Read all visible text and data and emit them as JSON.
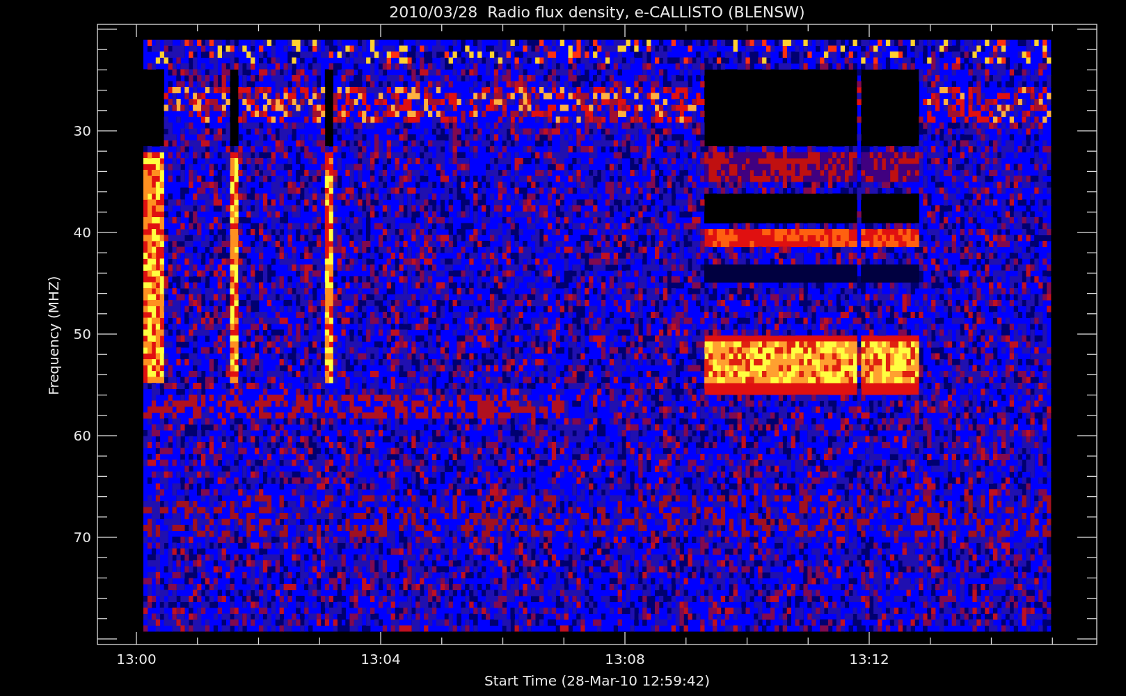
{
  "title": "2010/03/28  Radio flux density, e-CALLISTO (BLENSW)",
  "y_axis": {
    "label": "Frequency (MHZ)",
    "ticks": [
      "30",
      "40",
      "50",
      "60",
      "70"
    ]
  },
  "x_axis": {
    "label": "Start Time (28-Mar-10 12:59:42)",
    "ticks": [
      "13:00",
      "13:04",
      "13:08",
      "13:12"
    ]
  }
}
